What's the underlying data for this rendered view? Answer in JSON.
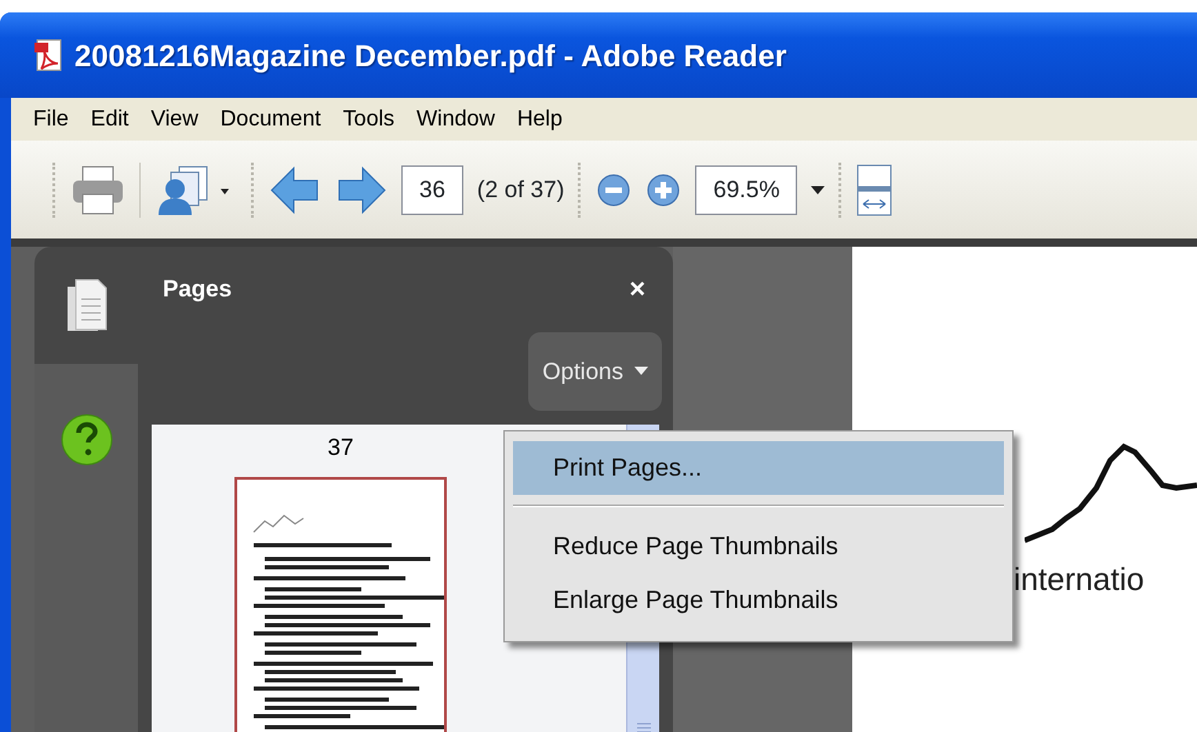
{
  "window": {
    "title": "20081216Magazine December.pdf - Adobe Reader"
  },
  "menu_bar": [
    "File",
    "Edit",
    "View",
    "Document",
    "Tools",
    "Window",
    "Help"
  ],
  "toolbar": {
    "page_field": "36",
    "page_count": "(2 of 37)",
    "zoom_field": "69.5%"
  },
  "side_panel": {
    "title": "Pages",
    "close": "×",
    "options_button": "Options",
    "thumbnail_label": "37"
  },
  "options_menu": [
    {
      "kind": "item",
      "label": "Print Pages...",
      "selected": true
    },
    {
      "kind": "separator"
    },
    {
      "kind": "item",
      "label": "Reduce Page Thumbnails",
      "selected": false
    },
    {
      "kind": "item",
      "label": "Enlarge Page Thumbnails",
      "selected": false
    }
  ],
  "document": {
    "visible_text": "internatio"
  }
}
